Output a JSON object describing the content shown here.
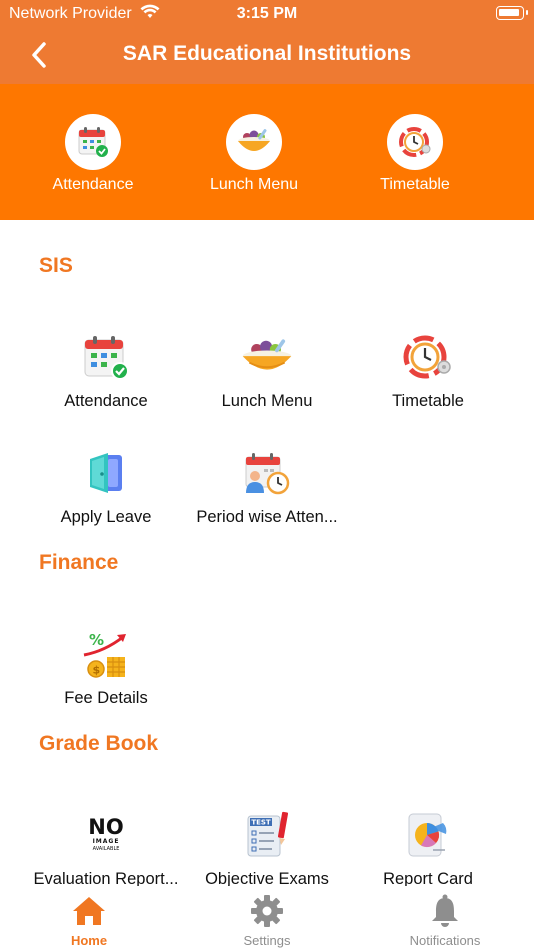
{
  "status_bar": {
    "carrier": "Network Provider",
    "time": "3:15 PM"
  },
  "header": {
    "title": "SAR Educational Institutions",
    "back_icon": "chevron-left-icon"
  },
  "quick_access": [
    {
      "label": "Attendance",
      "icon": "calendar-check-icon"
    },
    {
      "label": "Lunch Menu",
      "icon": "food-bowl-icon"
    },
    {
      "label": "Timetable",
      "icon": "clock-icon"
    }
  ],
  "sections": {
    "sis": {
      "title": "SIS",
      "items": [
        {
          "label": "Attendance",
          "icon": "calendar-check-icon"
        },
        {
          "label": "Lunch Menu",
          "icon": "food-bowl-icon"
        },
        {
          "label": "Timetable",
          "icon": "clock-icon"
        },
        {
          "label": "Apply Leave",
          "icon": "door-icon"
        },
        {
          "label": "Period wise Atten...",
          "icon": "calendar-user-clock-icon"
        }
      ]
    },
    "finance": {
      "title": "Finance",
      "items": [
        {
          "label": "Fee Details",
          "icon": "coins-growth-icon"
        }
      ]
    },
    "grade_book": {
      "title": "Grade Book",
      "items": [
        {
          "label": "Evaluation Report...",
          "icon": "no-image-icon",
          "image_text": [
            "NO",
            "IMAGE",
            "AVAILABLE"
          ]
        },
        {
          "label": "Objective Exams",
          "icon": "test-sheet-icon",
          "image_text": [
            "TEST"
          ]
        },
        {
          "label": "Report Card",
          "icon": "report-chart-icon"
        }
      ]
    }
  },
  "tab_bar": [
    {
      "label": "Home",
      "icon": "home-icon",
      "active": true
    },
    {
      "label": "Settings",
      "icon": "gear-icon",
      "active": false
    },
    {
      "label": "Notifications",
      "icon": "bell-icon",
      "active": false
    }
  ],
  "colors": {
    "header": "#ee7a32",
    "quick_bar": "#fe7700",
    "accent": "#f07722"
  }
}
